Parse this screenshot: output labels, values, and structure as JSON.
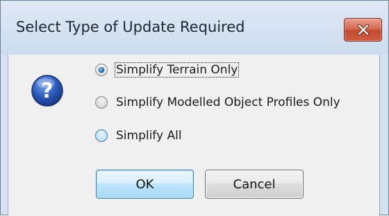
{
  "dialog": {
    "title": "Select Type of Update Required",
    "close_icon": "close-icon",
    "message_icon": "question-icon",
    "options": [
      {
        "label": "Simplify Terrain Only",
        "selected": true
      },
      {
        "label": "Simplify Modelled Object Profiles Only",
        "selected": false
      },
      {
        "label": "Simplify All",
        "selected": false
      }
    ],
    "buttons": {
      "ok_label": "OK",
      "cancel_label": "Cancel"
    }
  },
  "colors": {
    "title_bar": "#cddcee",
    "client_background": "#f0f0f0",
    "close_button": "#c24a2e",
    "default_button_border": "#3c7fb1"
  }
}
